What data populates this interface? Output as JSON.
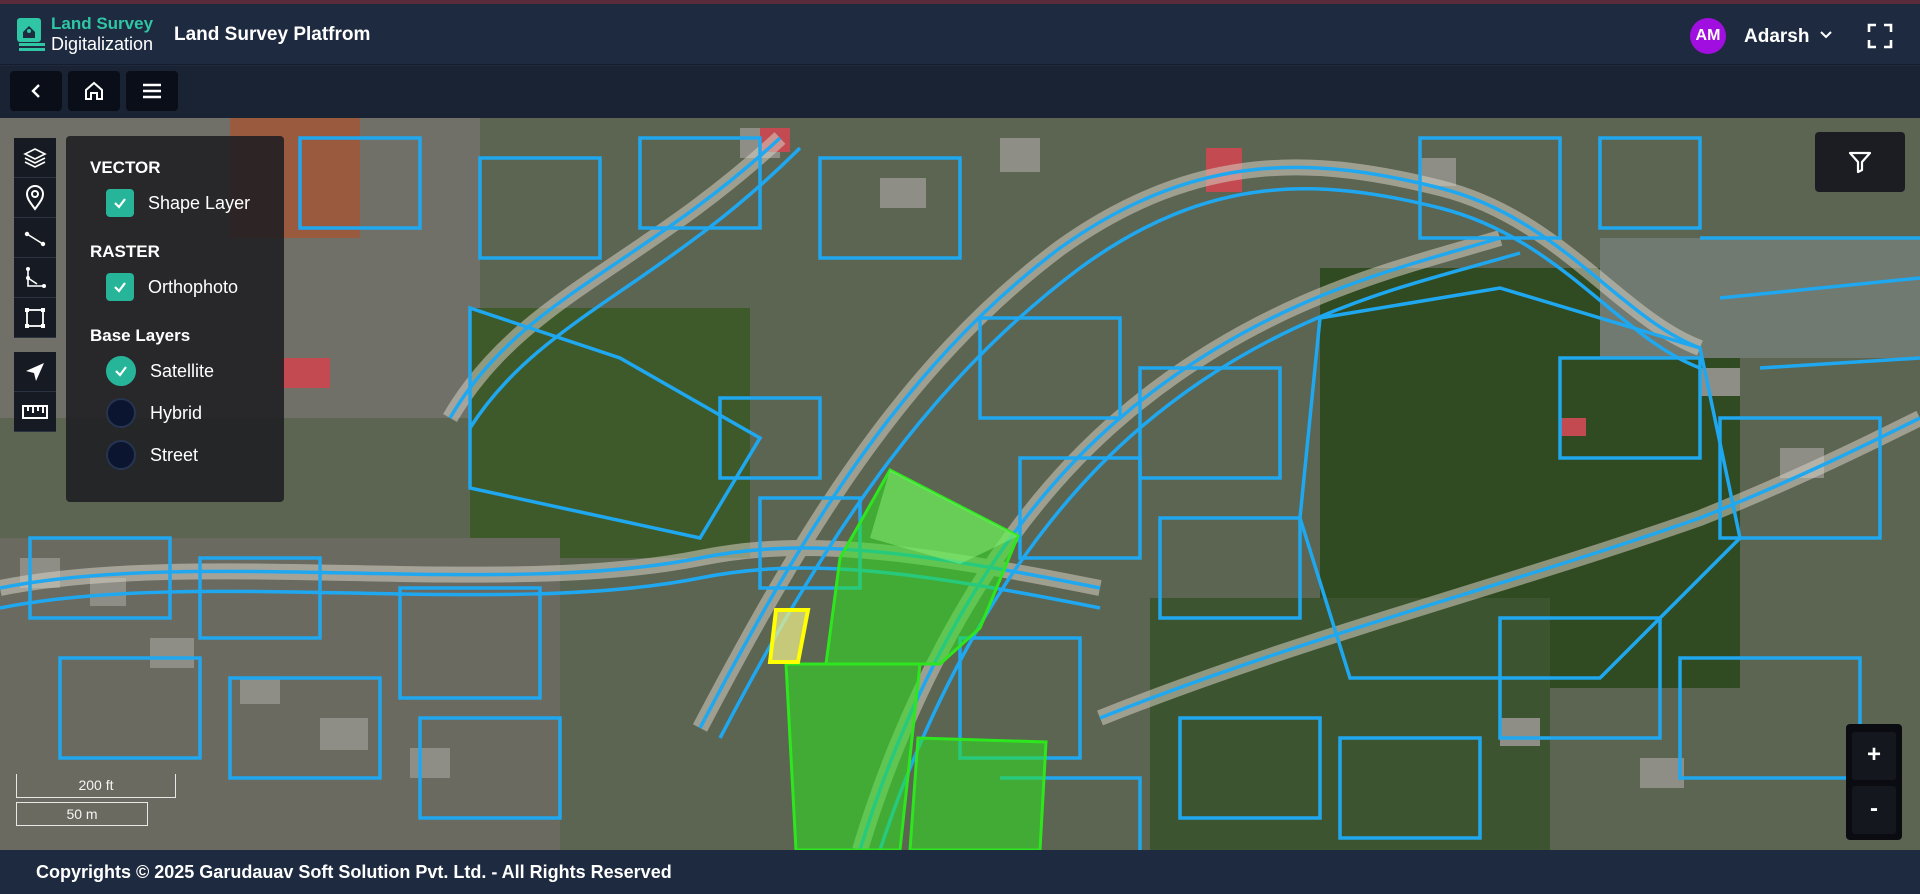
{
  "header": {
    "brand_line1": "Land Survey",
    "brand_line2": "Digitalization",
    "app_title": "Land Survey Platfrom",
    "user_initials": "AM",
    "user_name": "Adarsh"
  },
  "toolbar": {
    "icons": [
      "back-icon",
      "home-icon",
      "menu-icon"
    ]
  },
  "map": {
    "tools": [
      "layers-icon",
      "location-pin-icon",
      "line-icon",
      "polyline-icon",
      "polygon-icon",
      "navigate-icon",
      "ruler-icon"
    ],
    "layer_panel": {
      "vector_heading": "VECTOR",
      "shape_layer": "Shape Layer",
      "shape_layer_checked": true,
      "raster_heading": "RASTER",
      "orthophoto": "Orthophoto",
      "orthophoto_checked": true,
      "base_heading": "Base Layers",
      "base_options": [
        "Satellite",
        "Hybrid",
        "Street"
      ],
      "base_selected": "Satellite"
    },
    "zoom_in": "+",
    "zoom_out": "-",
    "scale_ft": "200 ft",
    "scale_m": "50 m",
    "colors": {
      "parcel_outline": "#1fa8f0",
      "selected_parcel": "#2ee61e",
      "highlight_parcel": "#ffff00",
      "accent": "#27b59a"
    }
  },
  "footer": {
    "copyright": "Copyrights © 2025 Garudauav Soft Solution Pvt. Ltd. - All Rights Reserved"
  }
}
